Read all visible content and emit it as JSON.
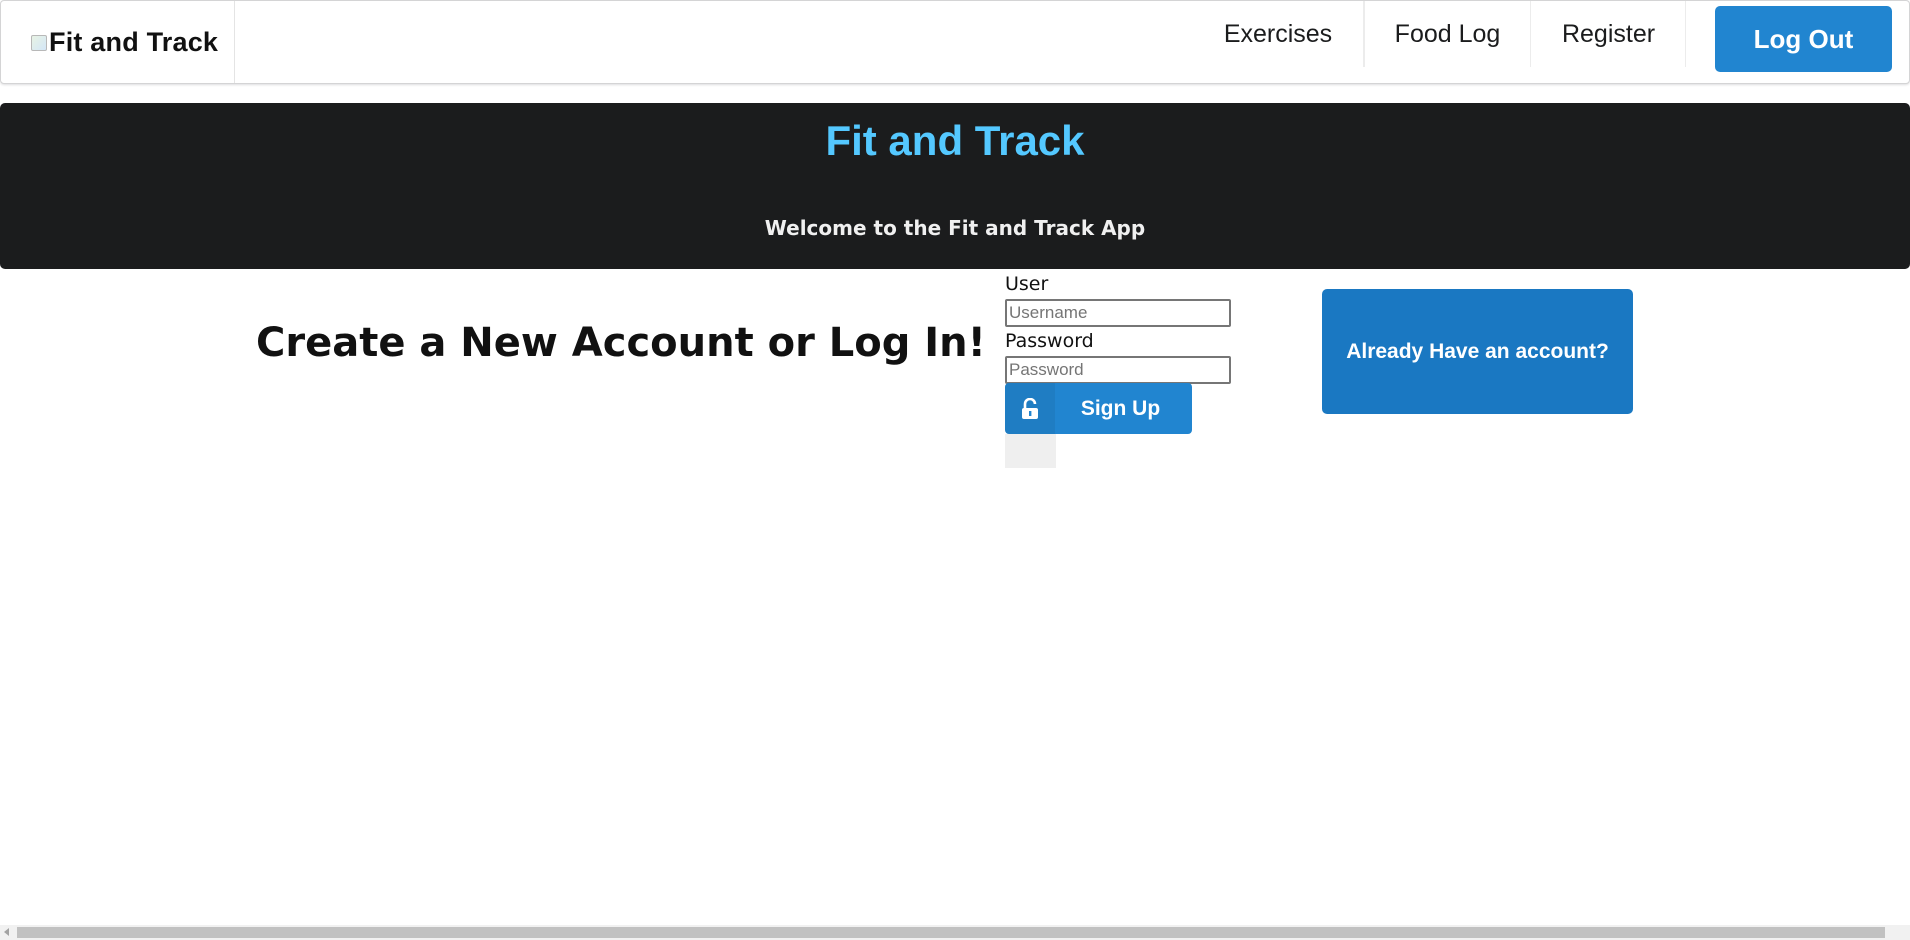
{
  "nav": {
    "brand": "Fit and Track",
    "brand_image_alt": "Fit and Track",
    "items": [
      {
        "label": "Exercises"
      },
      {
        "label": "Food Log"
      },
      {
        "label": "Register"
      }
    ],
    "logout_label": "Log Out"
  },
  "banner": {
    "title": "Fit and Track",
    "subtitle": "Welcome to the Fit and Track App"
  },
  "main": {
    "headline": "Create a New Account or Log In!",
    "form": {
      "user_label": "User",
      "user_placeholder": "Username",
      "user_value": "",
      "password_label": "Password",
      "password_placeholder": "Password",
      "password_value": "",
      "signup_label": "Sign Up",
      "signup_icon": "unlock-icon"
    },
    "have_account_label": "Already Have an account?"
  },
  "colors": {
    "primary": "#2185d0",
    "banner_bg": "#1b1c1d",
    "banner_title": "#54c8ff",
    "secondary_button": "#1a78c2"
  }
}
